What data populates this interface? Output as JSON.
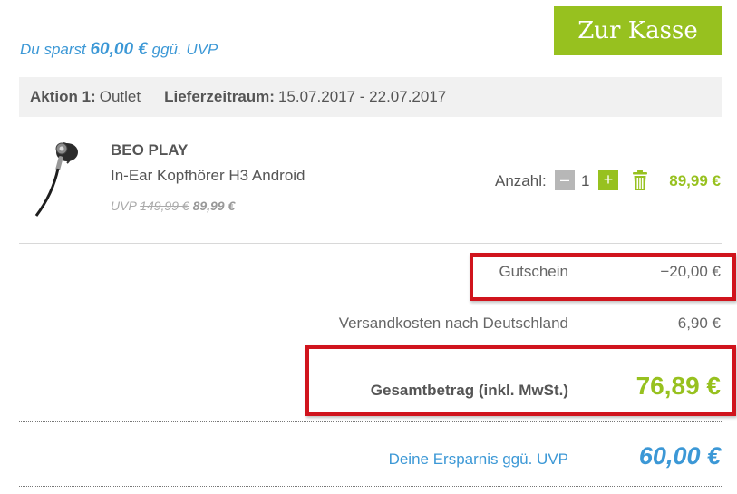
{
  "checkout": {
    "button_label": "Zur Kasse",
    "color": "#97c11f"
  },
  "savings_top": {
    "prefix": "Du sparst",
    "amount": "60,00 €",
    "suffix": "ggü. UVP"
  },
  "action_bar": {
    "action_label": "Aktion 1:",
    "action_value": "Outlet",
    "delivery_label": "Lieferzeitraum:",
    "delivery_value": "15.07.2017 - 22.07.2017"
  },
  "item": {
    "brand": "BEO PLAY",
    "model": "In-Ear Kopfhörer H3 Android",
    "uvp_label": "UVP",
    "uvp_old_price": "149,99 €",
    "uvp_new_price": "89,99 €",
    "quantity_label": "Anzahl:",
    "quantity_minus": "–",
    "quantity": "1",
    "quantity_plus": "+",
    "price": "89,99 €",
    "delete_icon": "trash-icon"
  },
  "summary": {
    "voucher_label": "Gutschein",
    "voucher_value": "−20,00 €",
    "shipping_label": "Versandkosten nach Deutschland",
    "shipping_value": "6,90 €",
    "total_label": "Gesamtbetrag (inkl. MwSt.)",
    "total_value": "76,89 €",
    "saving_label": "Deine Ersparnis ggü. UVP",
    "saving_value": "60,00 €"
  },
  "colors": {
    "accent_green": "#97c11f",
    "accent_blue": "#3c98d6",
    "highlight_red": "#d0141d"
  }
}
